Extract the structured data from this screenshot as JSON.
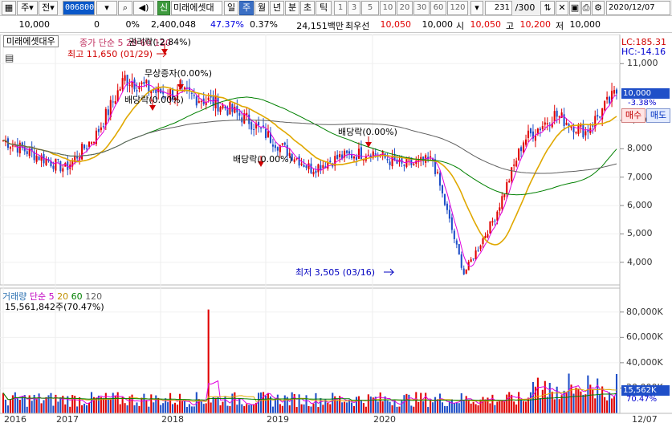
{
  "toolbar": {
    "type_label": "주",
    "prev_label": "전",
    "code": "006800",
    "stock_badge": "신",
    "stock_name": "미래에셋대",
    "periods": [
      "일",
      "주",
      "월",
      "년",
      "분",
      "초",
      "틱"
    ],
    "selected_period": "주",
    "intervals": [
      "1",
      "3",
      "5",
      "10",
      "20",
      "30",
      "60",
      "120"
    ],
    "page_counter": "231",
    "page_total": "/300",
    "date": "2020/12/07"
  },
  "quote": {
    "price": "10,000",
    "change": "0",
    "change_pct": "0%",
    "volume": "2,400,048",
    "turnover_pct": "47.37%",
    "ratio_pct": "0.37%",
    "amount": "24,151백만",
    "best_ask_label": "최우선",
    "best_ask": "10,050",
    "current": "10,000",
    "open_label": "시",
    "open": "10,050",
    "high_label": "고",
    "high": "10,200",
    "low_label": "저",
    "low": "10,000"
  },
  "chart": {
    "title": "미래에셋대우",
    "legend": "종가 단순 5 20 60 120",
    "lc": "LC:185.31",
    "hc": "HC:-14.16",
    "price_ticks": [
      "11,000",
      "9,000",
      "8,000",
      "7,000",
      "6,000",
      "5,000",
      "4,000"
    ],
    "current_price": "10,000",
    "current_change": "-3.38%",
    "buy_label": "매수",
    "sell_label": "매도",
    "high_annotation": "최고 11,650 (01/29)",
    "low_annotation": "최저 3,505 (03/16)",
    "events": [
      "권리락(-2.84%)",
      "무상증자(0.00%)",
      "배당락(0.00%)",
      "배당락(0.00%)",
      "배당락(0.00%)"
    ],
    "volume_legend_name": "거래량",
    "volume_legend_ma": "단순",
    "volume_legend_periods": [
      "5",
      "20",
      "60",
      "120"
    ],
    "volume_current": "15,561,842주(70.47%)",
    "volume_ticks": [
      "80,000K",
      "60,000K",
      "40,000K",
      "20,000K"
    ],
    "volume_badge": "15,562K",
    "volume_badge_pct": "70.47%",
    "x_ticks": [
      "2016",
      "2017",
      "2018",
      "2019",
      "2020"
    ],
    "x_last": "12/07"
  },
  "colors": {
    "up": "#e00000",
    "down": "#1f4fc8",
    "ma5": "#e000e0",
    "ma20": "#e0a800",
    "ma60": "#008000",
    "ma120": "#606060",
    "selected": "#3b6fc4"
  },
  "chart_data": {
    "type": "line",
    "price": {
      "x": [
        "2016/01",
        "2016/07",
        "2017/01",
        "2017/04",
        "2017/07",
        "2017/10",
        "2018/01",
        "2018/04",
        "2018/07",
        "2018/10",
        "2019/01",
        "2019/04",
        "2019/07",
        "2019/10",
        "2020/01",
        "2020/03",
        "2020/05",
        "2020/07",
        "2020/09",
        "2020/11",
        "2020/12"
      ],
      "y": [
        8300,
        7800,
        7300,
        8500,
        10500,
        10000,
        9900,
        9600,
        9000,
        8100,
        7300,
        7700,
        7900,
        7400,
        7600,
        3600,
        5600,
        8300,
        9200,
        8600,
        10000
      ]
    },
    "ylim": [
      3400,
      11800
    ],
    "volume_ylim": [
      0,
      90000
    ],
    "volume_unit": "K"
  }
}
